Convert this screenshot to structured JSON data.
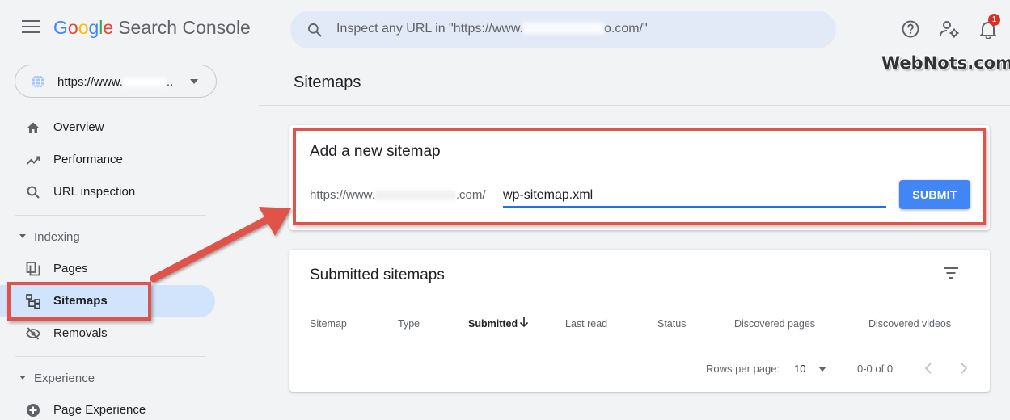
{
  "header": {
    "logo_google": [
      "G",
      "o",
      "o",
      "g",
      "l",
      "e"
    ],
    "logo_product": "Search Console",
    "search_placeholder_start": "Inspect any URL in \"https://www.",
    "search_placeholder_end": "o.com/\"",
    "notification_count": "1"
  },
  "watermark": "WebNots.com",
  "sidebar": {
    "property_prefix": "https://www.",
    "property_suffix": "..",
    "items": [
      {
        "label": "Overview",
        "icon": "home-icon"
      },
      {
        "label": "Performance",
        "icon": "trend-icon"
      },
      {
        "label": "URL inspection",
        "icon": "search-icon"
      }
    ],
    "sections": [
      {
        "label": "Indexing"
      },
      {
        "label": "Experience"
      }
    ],
    "indexing_items": [
      {
        "label": "Pages",
        "icon": "pages-icon"
      },
      {
        "label": "Sitemaps",
        "icon": "sitemap-icon"
      },
      {
        "label": "Removals",
        "icon": "eye-off-icon"
      }
    ],
    "experience_items": [
      {
        "label": "Page Experience",
        "icon": "plus-circle-icon"
      }
    ]
  },
  "main": {
    "title": "Sitemaps",
    "add_card": {
      "title": "Add a new sitemap",
      "url_prefix_start": "https://www.",
      "url_prefix_end": ".com/",
      "input_value": "wp-sitemap.xml",
      "submit_label": "SUBMIT"
    },
    "submitted_card": {
      "title": "Submitted sitemaps",
      "columns": [
        "Sitemap",
        "Type",
        "Submitted",
        "Last read",
        "Status",
        "Discovered pages",
        "Discovered videos"
      ],
      "rows_per_page_label": "Rows per page:",
      "rows_per_page_value": "10",
      "range": "0-0 of 0"
    }
  },
  "colors": {
    "accent": "#4285f4",
    "highlight": "#e0524a",
    "active_nav": "#d2e3fc"
  }
}
